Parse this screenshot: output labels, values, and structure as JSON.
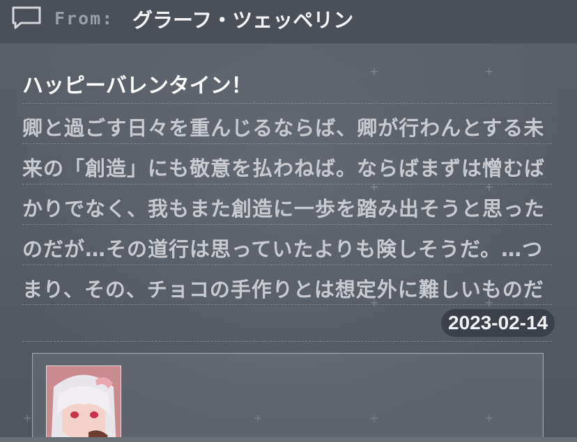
{
  "header": {
    "from_label": "From:",
    "sender": "グラーフ・ツェッペリン",
    "icon": "chat-bubble-icon"
  },
  "message": {
    "subject": "ハッピーバレンタイン！",
    "lines": [
      "卿と過ごす日々を重んじるならば、卿が行わんとする未",
      "来の「創造」にも敬意を払わねば。ならばまずは憎むば",
      "かりでなく、我もまた創造に一歩を踏み出そうと思った",
      "のだが…その道行は思っていたよりも険しそうだ。…つ",
      "まり、その、チョコの手作りとは想定外に難しいものだ"
    ],
    "date": "2023-02-14"
  },
  "attachment": {
    "avatar_badge": "1"
  },
  "colors": {
    "background": "#555a63",
    "header": "#4b4f57",
    "badge": "#3c4048"
  }
}
